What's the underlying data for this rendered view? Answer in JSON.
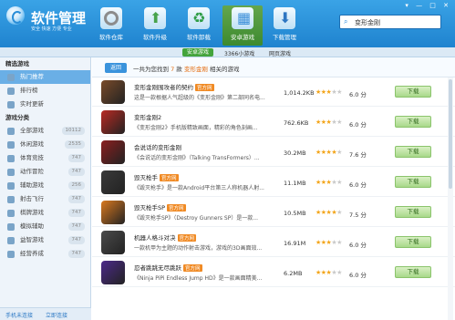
{
  "app": {
    "title": "软件管理",
    "subtitle": "安全 快速 方便 专业"
  },
  "toolbar": [
    {
      "label": "软件仓库",
      "icon": "disc-icon",
      "active": false
    },
    {
      "label": "软件升级",
      "icon": "upgrade-icon",
      "active": false
    },
    {
      "label": "软件卸载",
      "icon": "recycle-icon",
      "active": false
    },
    {
      "label": "安卓游戏",
      "icon": "game-icon",
      "active": true
    },
    {
      "label": "下载管理",
      "icon": "download-icon",
      "active": false
    }
  ],
  "search": {
    "value": "变形金刚"
  },
  "subbar": {
    "pill": "安卓游戏",
    "count": "3366小游戏",
    "web": "网页游戏"
  },
  "sidebar": {
    "sec1": "精选游戏",
    "sec1_items": [
      {
        "label": "热门推荐",
        "active": true
      },
      {
        "label": "排行榜"
      },
      {
        "label": "实时更新"
      }
    ],
    "sec2": "游戏分类",
    "sec2_items": [
      {
        "label": "全部游戏",
        "count": "10112"
      },
      {
        "label": "休闲游戏",
        "count": "2535"
      },
      {
        "label": "体育竞技",
        "count": "747"
      },
      {
        "label": "动作冒险",
        "count": "747"
      },
      {
        "label": "辅助游戏",
        "count": "256"
      },
      {
        "label": "射击飞行",
        "count": "747"
      },
      {
        "label": "棋牌游戏",
        "count": "747"
      },
      {
        "label": "模拟辅助",
        "count": "747"
      },
      {
        "label": "益智游戏",
        "count": "747"
      },
      {
        "label": "经营养成",
        "count": "747"
      }
    ],
    "foot": [
      "手机未连接",
      "立即连接"
    ]
  },
  "results": {
    "back": "返回",
    "prefix": "一共为您找到",
    "count": "7",
    "mid": "款",
    "keyword": "变形金刚",
    "suffix": "相关的游戏"
  },
  "rows": [
    {
      "name": "变形金刚围攻者的契约",
      "tag": "官方网",
      "desc": "这是一款根据人气超级的《变形金刚》第二部同名电...",
      "size": "1,014.2KB",
      "rating": 3,
      "score": "6.0 分",
      "button": "下载",
      "color": "#7a4b2a"
    },
    {
      "name": "变形金刚2",
      "tag": "",
      "desc": "《变形金刚2》手机版精致画面，精彩的角色刻画...",
      "size": "762.6KB",
      "rating": 3,
      "score": "6.0 分",
      "button": "下载",
      "color": "#b92a23"
    },
    {
      "name": "会说话的变形金刚",
      "tag": "",
      "desc": "《会说话的变形金刚》（Talking TransFormers）...",
      "size": "30.2MB",
      "rating": 4,
      "score": "7.6 分",
      "button": "下载",
      "color": "#8b1f1f"
    },
    {
      "name": "毁灭枪手",
      "tag": "官方网",
      "desc": "《毁灭枪手》是一款Android平台第三人称机器人射...",
      "size": "11.1MB",
      "rating": 3,
      "score": "6.0 分",
      "button": "下载",
      "color": "#3a3a3a"
    },
    {
      "name": "毁灭枪手SP",
      "tag": "官方网",
      "desc": "《毁灭枪手SP》（Destroy Gunners SP）是一款...",
      "size": "10.5MB",
      "rating": 4,
      "score": "7.5 分",
      "button": "下载",
      "color": "#d9791f"
    },
    {
      "name": "机器人格斗对决",
      "tag": "官方网",
      "desc": "一款机甲为主题的动作射击游戏，游戏的3D画面效...",
      "size": "16.91M",
      "rating": 3,
      "score": "6.0 分",
      "button": "下载",
      "color": "#4b4b4b"
    },
    {
      "name": "忍者跳跳无尽跳跃",
      "tag": "官方网",
      "desc": "《Ninja PiPi Endless Jump HD》是一款画面精美...",
      "size": "6.2MB",
      "rating": 3,
      "score": "6.0 分",
      "button": "下载",
      "color": "#4c2a8a"
    }
  ]
}
